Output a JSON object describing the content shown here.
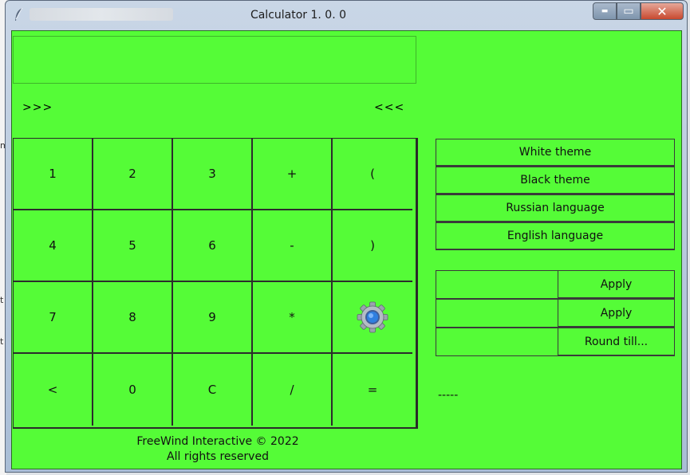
{
  "window": {
    "title": "Calculator 1. 0. 0",
    "minimize_glyph": "▬",
    "maximize_glyph": "▭",
    "close_glyph": "✕"
  },
  "display": {
    "value": ""
  },
  "nav": {
    "forward": ">>>",
    "back": "<<<"
  },
  "keypad": {
    "keys": [
      "1",
      "2",
      "3",
      "+",
      "(",
      "4",
      "5",
      "6",
      "-",
      ")",
      "7",
      "8",
      "9",
      "*",
      "",
      "<",
      "0",
      "C",
      "/",
      "="
    ],
    "settings_icon": "gear-icon"
  },
  "footer": {
    "line1": "FreeWind Interactive © 2022",
    "line2": "All rights reserved"
  },
  "theme_buttons": [
    "White theme",
    "Black theme",
    "Russian language",
    "English language"
  ],
  "inputs": [
    {
      "value": "",
      "button": "Apply"
    },
    {
      "value": "",
      "button": "Apply"
    },
    {
      "value": "",
      "button": "Round till..."
    }
  ],
  "status": "-----",
  "colors": {
    "background": "#55fc37",
    "border": "#2c2c2c",
    "text": "#111111"
  }
}
